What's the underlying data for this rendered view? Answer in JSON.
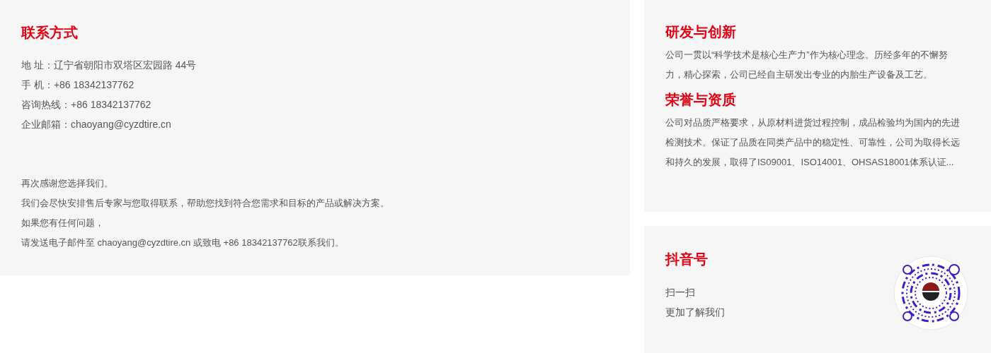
{
  "contact": {
    "title": "联系方式",
    "details": [
      {
        "label": "地 址：",
        "value": "辽宁省朝阳市双塔区宏园路 44号"
      },
      {
        "label": "手 机：",
        "value": "+86 18342137762"
      },
      {
        "label": "咨询热线：",
        "value": "+86 18342137762"
      },
      {
        "label": "企业邮箱：",
        "value": "chaoyang@cyzdtire.cn"
      }
    ],
    "message": [
      "再次感谢您选择我们。",
      "我们会尽快安排售后专家与您取得联系，帮助您找到符合您需求和目标的产品或解决方案。",
      "如果您有任何问题，",
      "请发送电子邮件至 chaoyang@cyzdtire.cn 或致电 +86 18342137762联系我们。"
    ]
  },
  "about": [
    {
      "title": "研发与创新",
      "text": "公司一贯以“科学技术是核心生产力”作为核心理念。历经多年的不懈努力，精心探索，公司已经自主研发出专业的内胎生产设备及工艺。"
    },
    {
      "title": "荣誉与资质",
      "text": "公司对品质严格要求，从原材料进货过程控制，成品检验均为国内的先进检测技术。保证了品质在同类产品中的稳定性、可靠性，公司为取得长远和持久的发展，取得了IS09001、ISO14001、OHSAS18001体系认证..."
    }
  ],
  "douyin": {
    "title": "抖音号",
    "lines": [
      "扫一扫",
      "更加了解我们"
    ]
  }
}
